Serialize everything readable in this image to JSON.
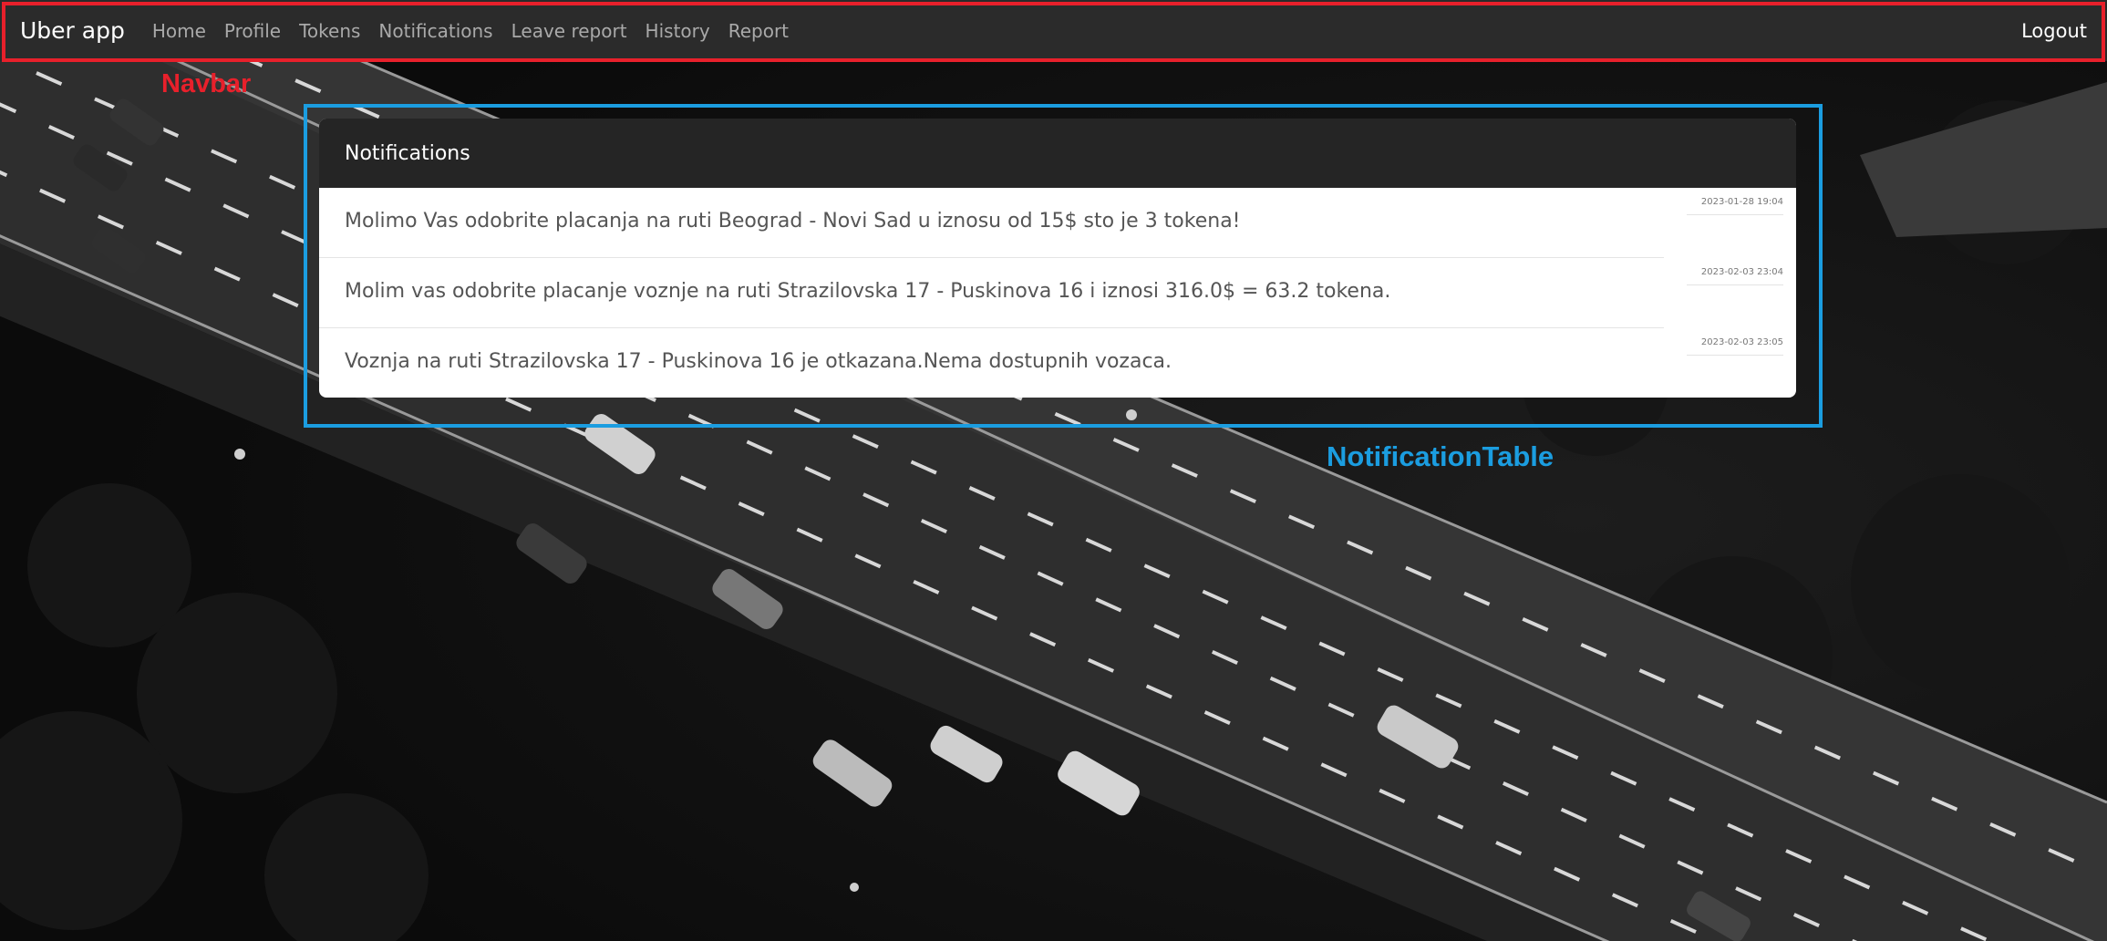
{
  "navbar": {
    "brand": "Uber app",
    "links": [
      "Home",
      "Profile",
      "Tokens",
      "Notifications",
      "Leave report",
      "History",
      "Report"
    ],
    "logout": "Logout"
  },
  "annotations": {
    "navbar_label": "Navbar",
    "table_label": "NotificationTable",
    "navbar_color": "#e8202b",
    "table_color": "#1b9de0"
  },
  "notifications": {
    "title": "Notifications",
    "items": [
      {
        "text": "Molimo Vas odobrite placanja na ruti Beograd - Novi Sad u iznosu od 15$ sto je 3 tokena!",
        "time": "2023-01-28 19:04"
      },
      {
        "text": "Molim vas odobrite placanje voznje na ruti Strazilovska 17 - Puskinova 16 i iznosi 316.0$ = 63.2 tokena.",
        "time": "2023-02-03 23:04"
      },
      {
        "text": "Voznja na ruti Strazilovska 17 - Puskinova 16 je otkazana.Nema dostupnih vozaca.",
        "time": "2023-02-03 23:05"
      }
    ]
  },
  "colors": {
    "navbar_bg": "#2b2b2b",
    "card_header_bg": "#252525",
    "card_body_bg": "#ffffff"
  }
}
